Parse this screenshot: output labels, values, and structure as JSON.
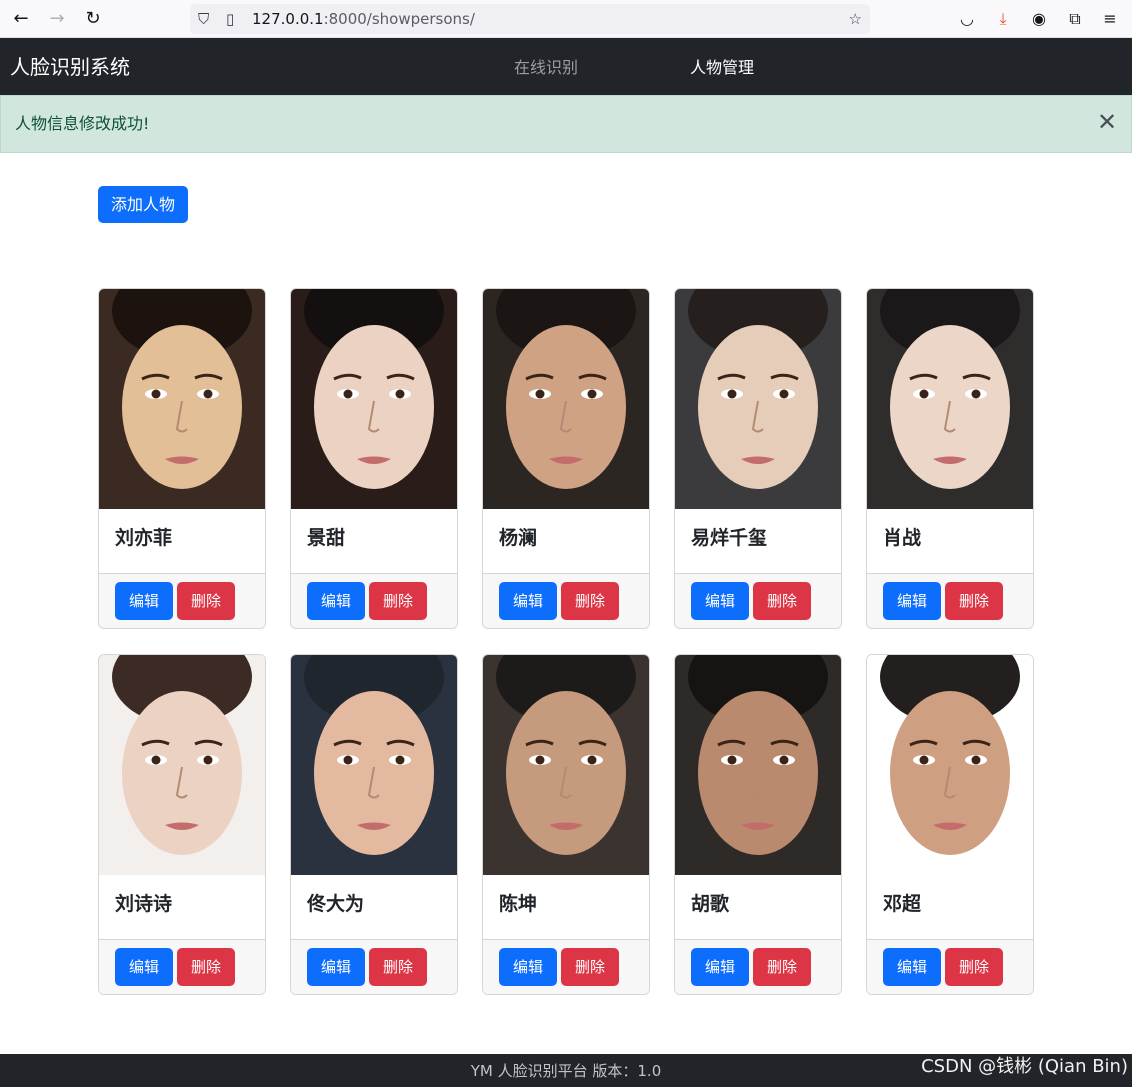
{
  "browser": {
    "back_icon": "arrow-left-icon",
    "forward_icon": "arrow-right-icon",
    "reload_icon": "reload-icon",
    "url_host": "127.0.0.1",
    "url_rest": ":8000/showpersons/"
  },
  "navbar": {
    "brand": "人脸识别系统",
    "links": [
      {
        "label": "在线识别"
      },
      {
        "label": "人物管理"
      }
    ]
  },
  "alert": {
    "message": "人物信息修改成功!"
  },
  "actions": {
    "add_label": "添加人物"
  },
  "card_buttons": {
    "edit": "编辑",
    "delete": "删除"
  },
  "persons": [
    {
      "name": "刘亦菲"
    },
    {
      "name": "景甜"
    },
    {
      "name": "杨澜"
    },
    {
      "name": "易烊千玺"
    },
    {
      "name": "肖战"
    },
    {
      "name": "刘诗诗"
    },
    {
      "name": "佟大为"
    },
    {
      "name": "陈坤"
    },
    {
      "name": "胡歌"
    },
    {
      "name": "邓超"
    }
  ],
  "footer": {
    "text": "YM 人脸识别平台  版本：1.0"
  },
  "watermark": "CSDN @钱彬 (Qian Bin)"
}
